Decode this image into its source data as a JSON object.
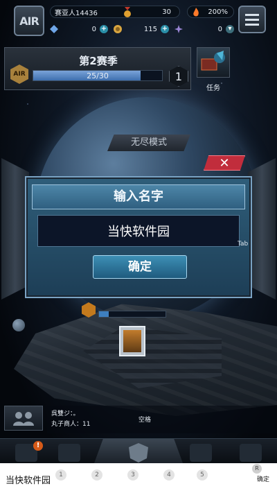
{
  "player": {
    "logo_text": "AIR",
    "name": "赛亚人14436",
    "level": "30",
    "bonus": "200%"
  },
  "resources": [
    {
      "icon": "crystal-icon",
      "value": "0"
    },
    {
      "icon": "coin-icon",
      "value": "115"
    },
    {
      "icon": "star-icon",
      "value": "0"
    }
  ],
  "season": {
    "title": "第2赛季",
    "emblem": "AIR",
    "progress_text": "25/30",
    "progress_ratio": 0.833,
    "rank": "1"
  },
  "task": {
    "label": "任务"
  },
  "mode": {
    "label": "无尽模式"
  },
  "dialog": {
    "title": "输入名字",
    "input_value": "当快软件园",
    "confirm_label": "确定",
    "close_symbol": "✕",
    "tab_hint": "Tab"
  },
  "ship": {
    "hp_ratio": 0.15
  },
  "chat": {
    "lines": [
      "呉雙ジ：。",
      "丸子商人：11"
    ],
    "space_hint": "空格"
  },
  "ime": {
    "candidate": "当快软件园",
    "numbers": [
      "1",
      "2",
      "3",
      "4",
      "5"
    ],
    "r_key": "R",
    "confirm": "确定"
  },
  "colors": {
    "accent": "#3d8fb5",
    "close": "#c12d3c",
    "warning": "#d65a18"
  }
}
